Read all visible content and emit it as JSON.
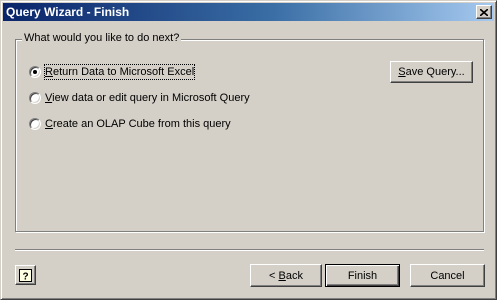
{
  "window": {
    "title": "Query Wizard - Finish",
    "close_icon": "close-icon"
  },
  "group": {
    "legend": "What would you like to do next?"
  },
  "options": [
    {
      "label_prefix": "",
      "mnemonic": "R",
      "label_rest": "eturn Data to Microsoft Excel",
      "checked": true
    },
    {
      "label_prefix": "",
      "mnemonic": "V",
      "label_rest": "iew data or edit query in Microsoft Query",
      "checked": false
    },
    {
      "label_prefix": "",
      "mnemonic": "C",
      "label_rest": "reate an OLAP Cube from this query",
      "checked": false
    }
  ],
  "buttons": {
    "save_query": {
      "mnemonic": "S",
      "rest": "ave Query..."
    },
    "back": {
      "prefix": "< ",
      "mnemonic": "B",
      "rest": "ack"
    },
    "finish": "Finish",
    "cancel": "Cancel",
    "help_icon": "help-icon"
  }
}
